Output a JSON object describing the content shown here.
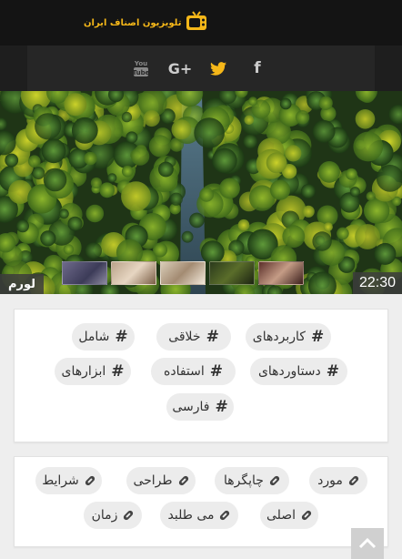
{
  "header": {
    "logo_text": "تلویزیون اصناف ایران",
    "logo_icon": "tv-icon",
    "accent_color": "#f5b719"
  },
  "social": {
    "items": [
      {
        "name": "youtube-icon",
        "label": "You Tube",
        "color": "#888888"
      },
      {
        "name": "google-plus-icon",
        "label": "G+",
        "color": "#cccccc"
      },
      {
        "name": "twitter-icon",
        "color": "#f5b719"
      },
      {
        "name": "facebook-icon",
        "label": "f",
        "color": "#cccccc"
      }
    ]
  },
  "hero": {
    "time": "22:30",
    "label": "لورم"
  },
  "tags_card": {
    "tags": [
      "کاربردهای",
      "خلاقی",
      "شامل",
      "دستاوردهای",
      "استفاده",
      "ابزارهای",
      "فارسی"
    ],
    "tag_icon": "hash-icon"
  },
  "keywords_card": {
    "tags": [
      "مورد",
      "چاپگرها",
      "طراحی",
      "شرایط",
      "اصلی",
      "می طلبد",
      "زمان"
    ],
    "tag_icon": "paperclip-icon"
  },
  "scroll_top": {
    "icon": "chevron-up-icon"
  }
}
